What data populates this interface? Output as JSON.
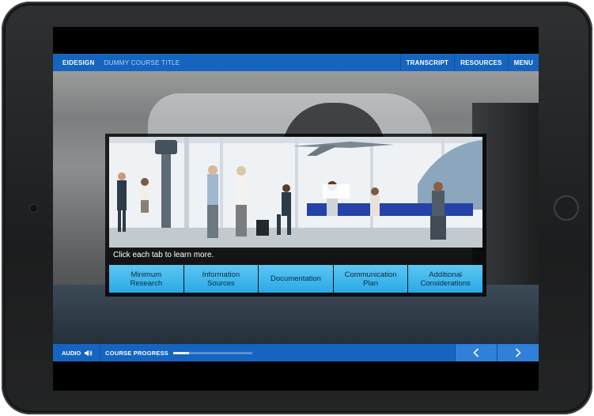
{
  "header": {
    "brand": "EIDESIGN",
    "course_title": "DUMMY COURSE TITLE",
    "transcript_label": "TRANSCRIPT",
    "resources_label": "RESOURCES",
    "menu_label": "MENU"
  },
  "main": {
    "instruction": "Click each tab to learn more.",
    "tabs": [
      {
        "line1": "Minimum",
        "line2": "Research"
      },
      {
        "line1": "Information",
        "line2": "Sources"
      },
      {
        "line1": "Documentation",
        "line2": ""
      },
      {
        "line1": "Communication",
        "line2": "Plan"
      },
      {
        "line1": "Additional",
        "line2": "Considerations"
      }
    ]
  },
  "footer": {
    "audio_label": "AUDIO",
    "progress_label": "COURSE PROGRESS",
    "progress_fraction": 0.2,
    "prev_icon": "chevron-left-icon",
    "next_icon": "chevron-right-icon"
  },
  "colors": {
    "bar_blue": "#1565c0",
    "tab_blue": "#2aa9e6"
  }
}
